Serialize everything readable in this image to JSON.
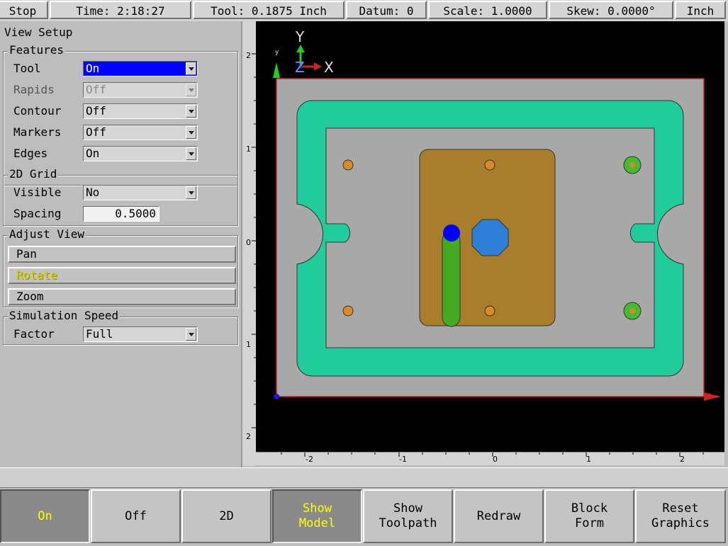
{
  "status_bar": {
    "stop": "Stop",
    "time": "Time: 2:18:27",
    "tool": "Tool: 0.1875 Inch",
    "datum": "Datum: 0",
    "scale": "Scale: 1.0000",
    "skew": "Skew: 0.0000°",
    "units": "Inch"
  },
  "panel": {
    "title": "View Setup",
    "features": {
      "label": "Features",
      "rows": [
        {
          "label": "Tool",
          "value": "On"
        },
        {
          "label": "Rapids",
          "value": "Off"
        },
        {
          "label": "Contour",
          "value": "Off"
        },
        {
          "label": "Markers",
          "value": "Off"
        },
        {
          "label": "Edges",
          "value": "On"
        }
      ]
    },
    "grid": {
      "label": "2D Grid",
      "visible_label": "Visible",
      "visible_value": "No",
      "spacing_label": "Spacing",
      "spacing_value": "0.5000"
    },
    "adjust": {
      "label": "Adjust View",
      "pan": "Pan",
      "rotate": "Rotate",
      "zoom": "Zoom"
    },
    "speed": {
      "label": "Simulation Speed",
      "factor_label": "Factor",
      "factor_value": "Full"
    }
  },
  "rulers": {
    "vertical": [
      "2",
      "1",
      "0",
      "1",
      "2"
    ],
    "horizontal": [
      "-2",
      "-1",
      "0",
      "1",
      "2"
    ]
  },
  "viewport": {
    "axes": {
      "y": "Y",
      "z": "Z",
      "x": "X",
      "small_y": "y"
    }
  },
  "softkeys": [
    {
      "label": "On",
      "active": true
    },
    {
      "label": "Off",
      "active": false
    },
    {
      "label": "2D",
      "active": false
    },
    {
      "label": "Show\nModel",
      "active": true
    },
    {
      "label": "Show\nToolpath",
      "active": false
    },
    {
      "label": "Redraw",
      "active": false
    },
    {
      "label": "Block\nForm",
      "active": false
    },
    {
      "label": "Reset\nGraphics",
      "active": false
    }
  ],
  "colors": {
    "stock": "#a8a8a8",
    "pocket_path": "#22cc9a",
    "boss": "#a87d2b",
    "slot": "#44aa22",
    "tool": "#0000ff",
    "octagon": "#2f7fd6",
    "hole_orange": "#d98a2b",
    "hole_green": "#44bb33"
  }
}
